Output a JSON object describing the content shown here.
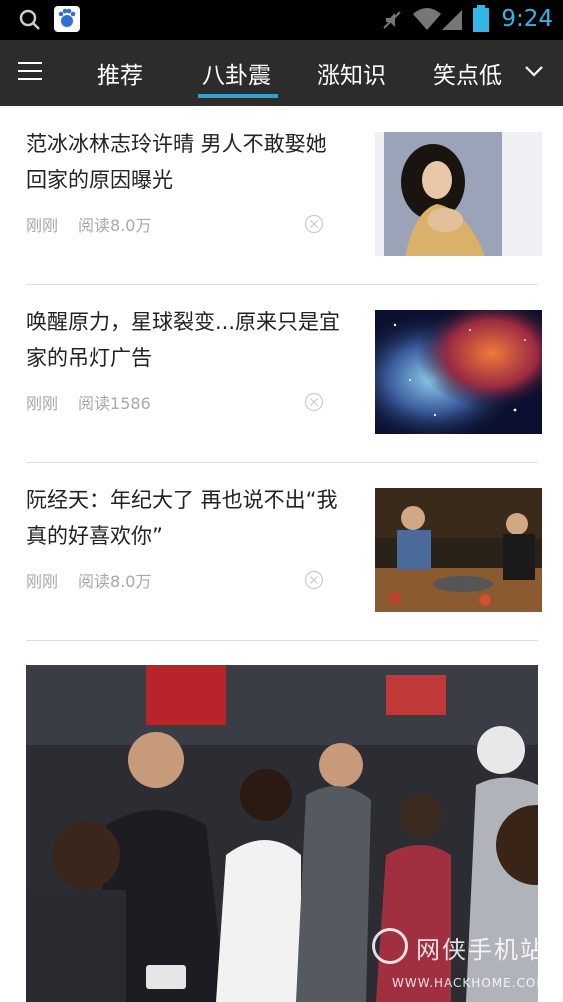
{
  "status_bar": {
    "time": "9:24",
    "icons": [
      "search-icon",
      "baidu-app-icon",
      "mute-icon",
      "wifi-icon",
      "signal-icon",
      "battery-icon"
    ]
  },
  "nav": {
    "tabs": [
      {
        "label": "推荐",
        "active": false
      },
      {
        "label": "八卦震",
        "active": true
      },
      {
        "label": "涨知识",
        "active": false
      },
      {
        "label": "笑点低",
        "active": false
      }
    ],
    "accent_color": "#2fa3c9"
  },
  "articles": [
    {
      "title": "范冰冰林志玲许晴 男人不敢娶她回家的原因曝光",
      "time": "刚刚",
      "reads": "阅读8.0万"
    },
    {
      "title": "唤醒原力，星球裂变...原来只是宜家的吊灯广告",
      "time": "刚刚",
      "reads": "阅读1586"
    },
    {
      "title": "阮经天：年纪大了 再也说不出“我真的好喜欢你”",
      "time": "刚刚",
      "reads": "阅读8.0万"
    }
  ],
  "watermark": {
    "text": "网侠手机站",
    "url_text": "WWW.HACKHOME.COM"
  }
}
